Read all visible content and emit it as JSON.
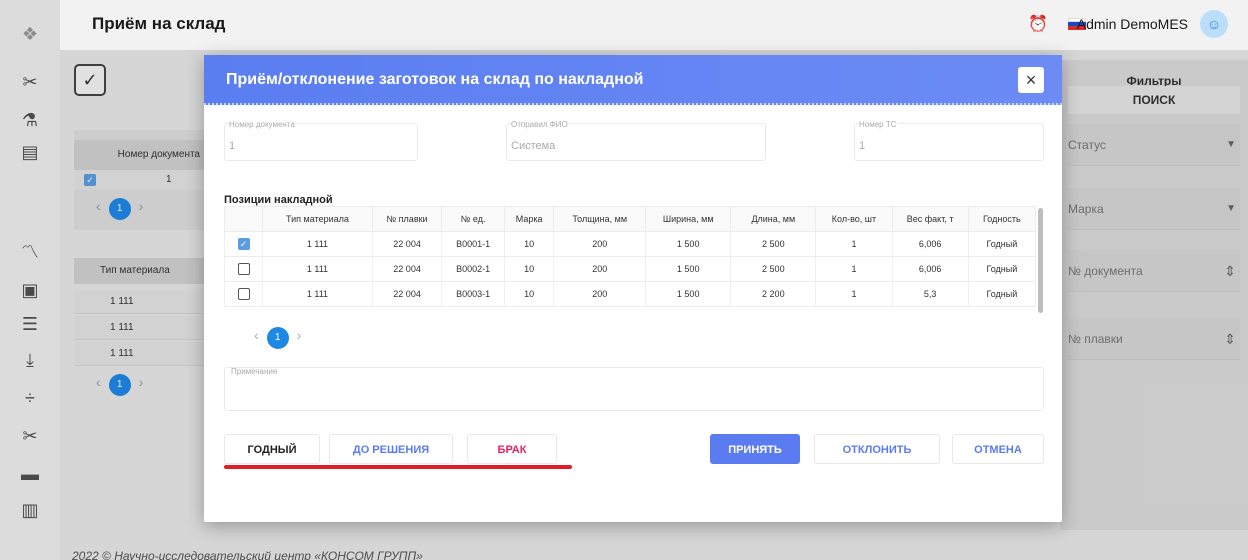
{
  "header": {
    "title": "Приём на склад",
    "user": "Admin DemoMES"
  },
  "sidebar": {
    "icons": [
      "logo-icon",
      "scissors-icon",
      "flask-icon",
      "archive-icon",
      "chart-icon",
      "monitor-icon",
      "list-icon",
      "download-icon",
      "split-icon",
      "scissors2-icon",
      "truck-icon",
      "book-icon"
    ]
  },
  "background": {
    "table1": {
      "header": "Номер документа",
      "row_value": "1"
    },
    "table2": {
      "header": "Тип материала",
      "rows": [
        "1 111",
        "1 111",
        "1 111"
      ]
    },
    "pager_page": "1",
    "footer": "2022 © Научно-исследовательский центр «КОНСОМ ГРУПП»"
  },
  "filters": {
    "title": "Фильтры",
    "search": "ПОИСК",
    "fields": [
      "Статус",
      "Марка",
      "№ документа",
      "№ плавки"
    ]
  },
  "dialog": {
    "title": "Приём/отклонение заготовок на склад по накладной",
    "close": "×",
    "fields": [
      {
        "label": "Номер документа",
        "value": "1"
      },
      {
        "label": "Отправил ФИО",
        "value": "Система"
      },
      {
        "label": "Номер ТС",
        "value": "1"
      }
    ],
    "section_title": "Позиции накладной",
    "columns": [
      "Тип материала",
      "№ плавки",
      "№ ед.",
      "Марка",
      "Толщина, мм",
      "Ширина, мм",
      "Длина, мм",
      "Кол-во, шт",
      "Вес факт, т",
      "Годность"
    ],
    "rows": [
      {
        "checked": true,
        "cells": [
          "1 111",
          "22 004",
          "B0001-1",
          "10",
          "200",
          "1 500",
          "2 500",
          "1",
          "6,006",
          "Годный"
        ]
      },
      {
        "checked": false,
        "cells": [
          "1 111",
          "22 004",
          "B0002-1",
          "10",
          "200",
          "1 500",
          "2 500",
          "1",
          "6,006",
          "Годный"
        ]
      },
      {
        "checked": false,
        "cells": [
          "1 111",
          "22 004",
          "B0003-1",
          "10",
          "200",
          "1 500",
          "2 200",
          "1",
          "5,3",
          "Годный"
        ]
      }
    ],
    "pager_page": "1",
    "note_label": "Примечание",
    "buttons": {
      "good": "ГОДНЫЙ",
      "pending": "ДО РЕШЕНИЯ",
      "reject": "БРАК",
      "accept": "ПРИНЯТЬ",
      "decline": "ОТКЛОНИТЬ",
      "cancel": "ОТМЕНА"
    }
  },
  "colors": {
    "accent": "#5b7cf0",
    "danger": "#e0245e",
    "underline": "#e01c2a"
  }
}
